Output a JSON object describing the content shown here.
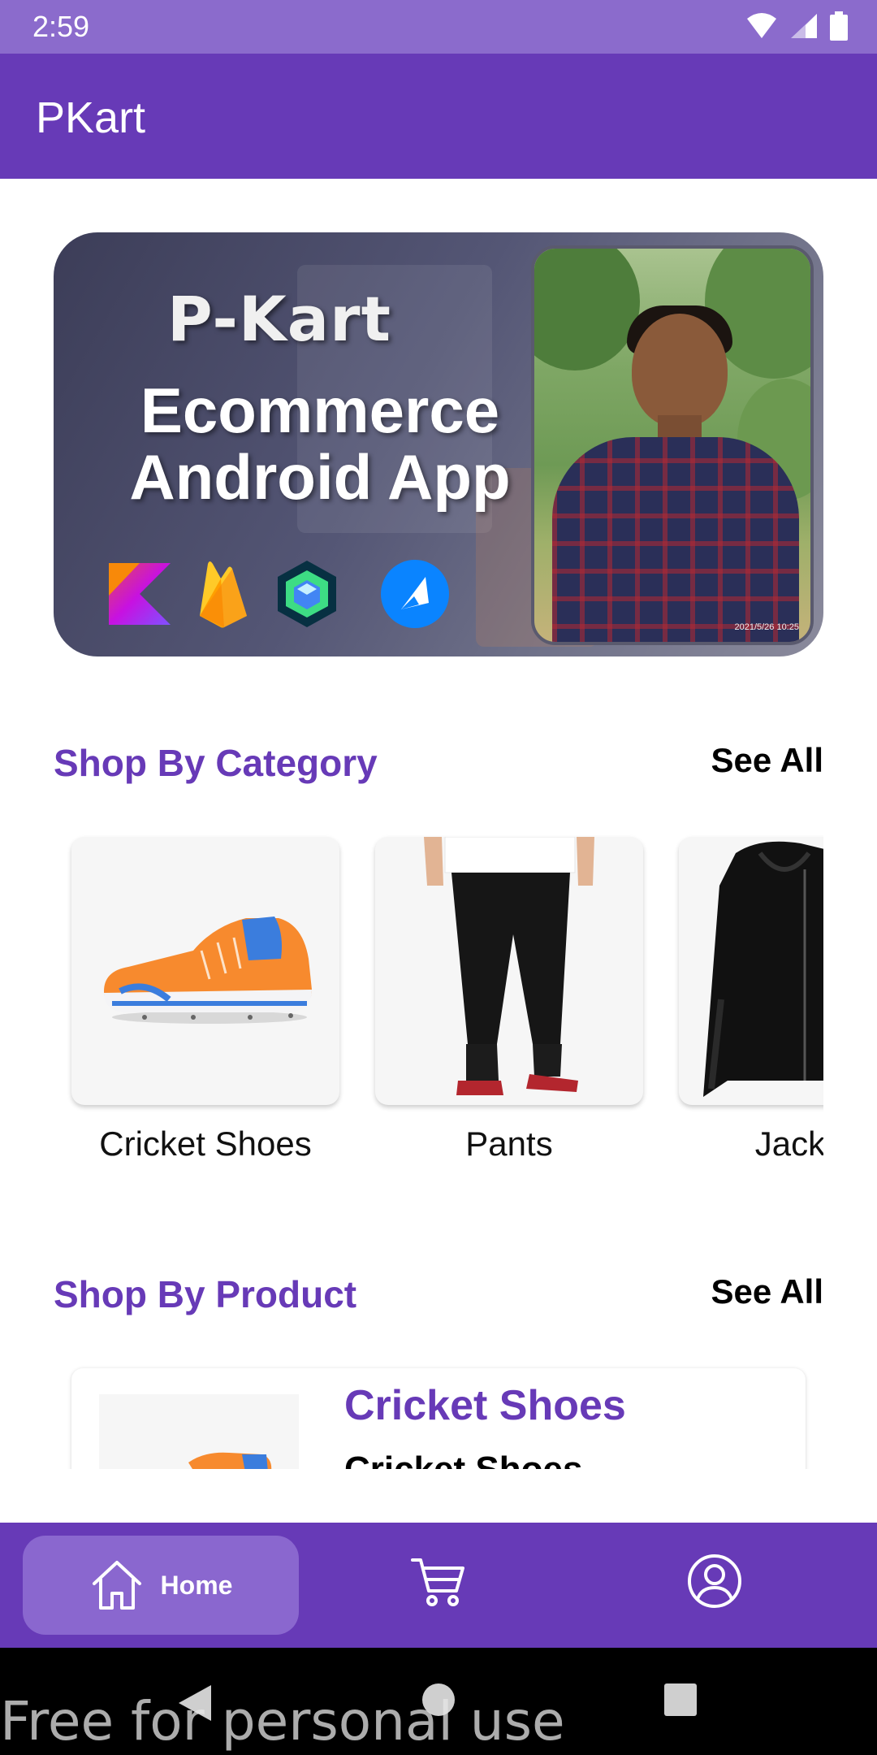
{
  "status_bar": {
    "time": "2:59",
    "icons": [
      "wifi-icon",
      "signal-icon",
      "battery-icon"
    ]
  },
  "app_bar": {
    "title": "PKart"
  },
  "banner": {
    "brand": "P-Kart",
    "headline": "Ecommerce Android App",
    "tech_logos": [
      "kotlin-logo",
      "firebase-logo",
      "jetpack-compose-logo",
      "tech-logo"
    ],
    "photo_timestamp": "2021/5/26 10:25"
  },
  "shop_by_category": {
    "title": "Shop By Category",
    "see_all": "See All",
    "items": [
      {
        "label": "Cricket Shoes",
        "image": "orange-shoe"
      },
      {
        "label": "Pants",
        "image": "black-pants"
      },
      {
        "label": "Jackets",
        "image": "black-hoodie"
      }
    ]
  },
  "shop_by_product": {
    "title": "Shop By Product",
    "see_all": "See All",
    "items": [
      {
        "title": "Cricket Shoes",
        "subtitle": "Cricket Shoes",
        "image": "orange-shoe"
      }
    ]
  },
  "bottom_nav": {
    "items": [
      {
        "label": "Home",
        "icon": "home-icon",
        "selected": true
      },
      {
        "label": "",
        "icon": "cart-icon",
        "selected": false
      },
      {
        "label": "",
        "icon": "profile-icon",
        "selected": false
      }
    ]
  },
  "system_nav": {
    "buttons": [
      "back-icon",
      "home-circle-icon",
      "recents-icon"
    ]
  },
  "watermark": "Free for personal use",
  "colors": {
    "primary": "#673ab7",
    "status_bar": "#8b6bcc",
    "nav_selected": "#8a67cf"
  }
}
